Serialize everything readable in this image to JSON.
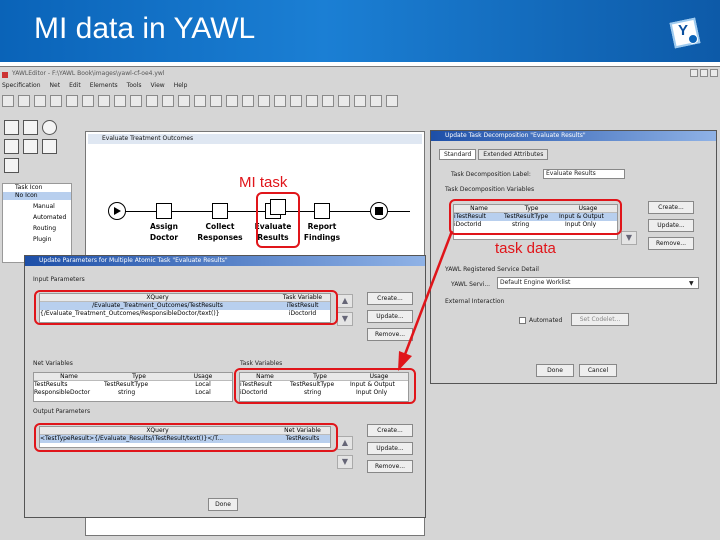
{
  "header": {
    "title": "MI data in YAWL",
    "logo_letter": "Y"
  },
  "app": {
    "window_title": "YAWLEditor - F:\\YAWL Book\\images\\yawl-cf-oe4.ywl",
    "menu": [
      "Specification",
      "Net",
      "Edit",
      "Elements",
      "Tools",
      "View",
      "Help"
    ],
    "tree": {
      "header": "Task Icon",
      "items": [
        "No Icon",
        "Manual",
        "Automated",
        "Routing",
        "Plugin"
      ]
    },
    "net": {
      "title": "Evaluate Treatment Outcomes",
      "tasks": [
        {
          "l1": "Assign",
          "l2": "Doctor"
        },
        {
          "l1": "Collect",
          "l2": "Responses"
        },
        {
          "l1": "Evaluate",
          "l2": "Results"
        },
        {
          "l1": "Report",
          "l2": "Findings"
        }
      ]
    }
  },
  "annotations": {
    "mi_task": "MI task",
    "task_data": "task data"
  },
  "decomp": {
    "title": "Update Task Decomposition \"Evaluate Results\"",
    "tabs": [
      "Standard",
      "Extended Attributes"
    ],
    "label_label": "Task Decomposition Label:",
    "label_value": "Evaluate Results",
    "vars_group": "Task Decomposition Variables",
    "vars_headers": [
      "Name",
      "Type",
      "Usage"
    ],
    "vars_rows": [
      [
        "iTestResult",
        "TestResultType",
        "Input & Output"
      ],
      [
        "iDoctorId",
        "string",
        "Input Only"
      ]
    ],
    "buttons": [
      "Create...",
      "Update...",
      "Remove..."
    ],
    "service_group": "YAWL Registered Service Detail",
    "service_label": "YAWL Servi...",
    "service_value": "Default Engine Worklist",
    "ext_group": "External Interaction",
    "automated_label": "Automated",
    "codelet_btn": "Set Codelet...",
    "done": "Done",
    "cancel": "Cancel"
  },
  "params": {
    "title": "Update Parameters for Multiple Atomic Task \"Evaluate Results\"",
    "input_group": "Input Parameters",
    "input_headers": [
      "XQuery",
      "Task Variable"
    ],
    "input_rows": [
      [
        "/Evaluate_Treatment_Outcomes/TestResults",
        "iTestResult"
      ],
      [
        "{/Evaluate_Treatment_Outcomes/ResponsibleDoctor/text()}",
        "iDoctorId"
      ]
    ],
    "net_group": "Net Variables",
    "net_headers": [
      "Name",
      "Type",
      "Usage"
    ],
    "net_rows": [
      [
        "TestResults",
        "TestResultType",
        "Local"
      ],
      [
        "ResponsibleDoctor",
        "string",
        "Local"
      ]
    ],
    "task_group": "Task Variables",
    "task_headers": [
      "Name",
      "Type",
      "Usage"
    ],
    "task_rows": [
      [
        "iTestResult",
        "TestResultType",
        "Input & Output"
      ],
      [
        "iDoctorId",
        "string",
        "Input Only"
      ]
    ],
    "output_group": "Output Parameters",
    "output_headers": [
      "XQuery",
      "Net Variable"
    ],
    "output_rows": [
      [
        "<TestTypeResult>{/Evaluate_Results/iTestResult/text()}</T...",
        "TestResults"
      ]
    ],
    "buttons": [
      "Create...",
      "Update...",
      "Remove..."
    ],
    "done": "Done"
  },
  "colors": {
    "header_blue": "#0a63b8",
    "annotation_red": "#e0151a",
    "selection_blue": "#b8cfee"
  }
}
